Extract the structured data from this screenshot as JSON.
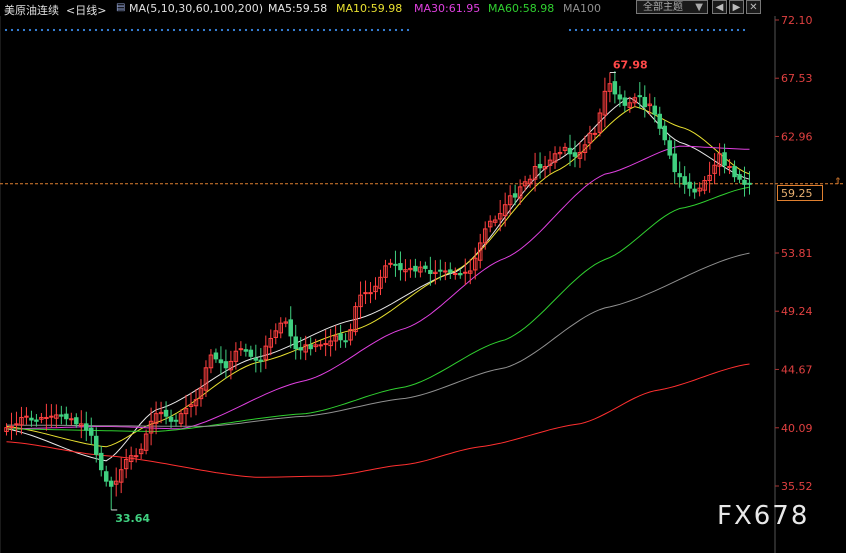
{
  "header": {
    "instrument": "美原油连续",
    "period": "<日线>",
    "ma_params": "MA(5,10,30,60,100,200)",
    "ma5": "MA5:59.58",
    "ma10": "MA10:59.98",
    "ma30": "MA30:61.95",
    "ma60": "MA60:58.98",
    "ma100": "MA100",
    "theme_label": "全部主题",
    "theme_arrow": "▼",
    "btn_prev": "◀",
    "btn_next": "▶",
    "btn_close": "✕"
  },
  "colors": {
    "up": "#ff4040",
    "down": "#40d080",
    "ma5": "#e8e8e8",
    "ma10": "#e8e030",
    "ma30": "#e040e0",
    "ma60": "#30d030",
    "ma100": "#909090",
    "ma200": "#ff3030"
  },
  "watermark": "FX678",
  "current_price_label": "59.25",
  "chart_data": {
    "type": "candlestick",
    "y_tick_labels": [
      "72.10",
      "67.53",
      "62.96",
      "59.25",
      "53.81",
      "49.24",
      "44.67",
      "40.09",
      "35.52"
    ],
    "ylim": [
      33.0,
      72.1
    ],
    "high_annotation": "67.98",
    "low_annotation": "33.64",
    "current_price": 59.25,
    "n_candles": 150,
    "close_series": [
      40.1,
      40.2,
      40.4,
      40.9,
      41.0,
      40.7,
      40.6,
      40.9,
      40.9,
      41.0,
      41.1,
      41.0,
      40.8,
      40.8,
      40.4,
      40.4,
      39.9,
      39.5,
      38.0,
      36.8,
      35.9,
      35.5,
      35.9,
      36.8,
      37.6,
      37.9,
      37.9,
      38.4,
      39.6,
      40.6,
      41.2,
      41.3,
      41.0,
      40.6,
      40.6,
      41.2,
      41.6,
      41.9,
      42.3,
      43.2,
      44.8,
      45.8,
      45.5,
      45.2,
      44.8,
      45.3,
      46.1,
      46.3,
      46.1,
      45.7,
      45.4,
      45.3,
      46.5,
      47.1,
      47.7,
      48.3,
      48.4,
      47.3,
      46.3,
      46.2,
      46.6,
      46.3,
      46.6,
      46.6,
      46.7,
      46.9,
      47.3,
      47.0,
      46.9,
      47.8,
      49.6,
      50.5,
      50.7,
      50.7,
      51.2,
      51.9,
      52.8,
      53.0,
      52.9,
      52.5,
      52.5,
      52.6,
      52.4,
      52.7,
      52.6,
      52.2,
      52.3,
      52.4,
      52.4,
      52.3,
      52.2,
      52.1,
      52.3,
      52.4,
      53.4,
      54.6,
      55.7,
      56.3,
      56.4,
      56.9,
      57.6,
      58.3,
      58.2,
      59.0,
      59.4,
      59.6,
      60.6,
      60.5,
      60.6,
      61.1,
      61.6,
      61.7,
      62.1,
      61.6,
      61.4,
      61.7,
      62.3,
      63.2,
      63.2,
      64.8,
      66.5,
      67.1,
      66.3,
      65.9,
      65.4,
      65.6,
      66.0,
      66.1,
      65.3,
      65.5,
      64.7,
      63.6,
      62.7,
      61.5,
      60.2,
      59.8,
      59.2,
      58.9,
      58.6,
      58.9,
      59.5,
      59.9,
      60.7,
      61.6,
      60.7,
      60.6,
      59.8,
      59.6,
      59.2,
      59.25
    ],
    "moving_averages": [
      {
        "name": "MA5",
        "points": [
          [
            0,
            40.0
          ],
          [
            20,
            37.5
          ],
          [
            30,
            41.5
          ],
          [
            50,
            45.6
          ],
          [
            70,
            48.6
          ],
          [
            90,
            52.3
          ],
          [
            110,
            61.0
          ],
          [
            125,
            66.0
          ],
          [
            135,
            62.5
          ],
          [
            149,
            59.6
          ]
        ]
      },
      {
        "name": "MA10",
        "points": [
          [
            0,
            40.2
          ],
          [
            20,
            38.6
          ],
          [
            30,
            40.5
          ],
          [
            50,
            45.2
          ],
          [
            70,
            47.8
          ],
          [
            90,
            52.4
          ],
          [
            110,
            60.2
          ],
          [
            126,
            65.3
          ],
          [
            136,
            63.6
          ],
          [
            149,
            60.0
          ]
        ]
      },
      {
        "name": "MA30",
        "points": [
          [
            0,
            40.0
          ],
          [
            20,
            40.2
          ],
          [
            35,
            40.0
          ],
          [
            60,
            43.8
          ],
          [
            80,
            47.9
          ],
          [
            100,
            53.4
          ],
          [
            120,
            60.0
          ],
          [
            135,
            62.2
          ],
          [
            149,
            61.95
          ]
        ]
      },
      {
        "name": "MA60",
        "points": [
          [
            0,
            40.0
          ],
          [
            30,
            39.8
          ],
          [
            60,
            41.2
          ],
          [
            80,
            43.3
          ],
          [
            100,
            47.0
          ],
          [
            120,
            53.3
          ],
          [
            135,
            57.3
          ],
          [
            149,
            58.98
          ]
        ]
      },
      {
        "name": "MA100",
        "points": [
          [
            0,
            40.3
          ],
          [
            40,
            40.2
          ],
          [
            60,
            41.0
          ],
          [
            80,
            42.4
          ],
          [
            100,
            44.8
          ],
          [
            120,
            49.5
          ],
          [
            149,
            53.8
          ]
        ]
      },
      {
        "name": "MA200",
        "points": [
          [
            0,
            39.0
          ],
          [
            20,
            37.9
          ],
          [
            50,
            36.2
          ],
          [
            65,
            36.3
          ],
          [
            80,
            37.2
          ],
          [
            95,
            38.6
          ],
          [
            115,
            40.4
          ],
          [
            130,
            43.0
          ],
          [
            149,
            45.1
          ]
        ]
      }
    ]
  }
}
